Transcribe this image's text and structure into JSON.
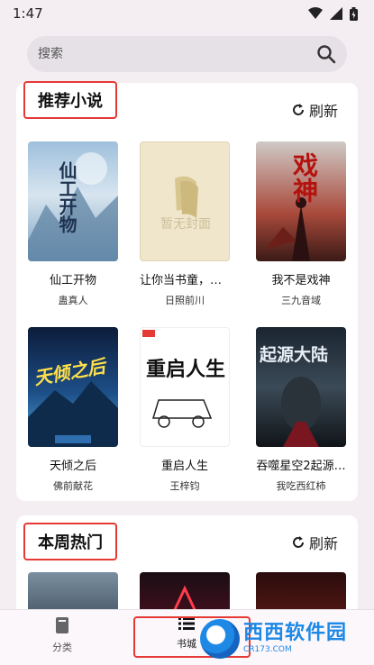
{
  "status": {
    "time": "1:47"
  },
  "search": {
    "placeholder": "搜索"
  },
  "recommend": {
    "title": "推荐小说",
    "refresh_label": "刷新",
    "books": [
      {
        "title": "仙工开物",
        "author": "蛊真人",
        "cover_text": "仙工开物"
      },
      {
        "title": "让你当书童，你…",
        "author": "日照前川",
        "cover_text": "暂无封面"
      },
      {
        "title": "我不是戏神",
        "author": "三九音域",
        "cover_text": "戏神"
      },
      {
        "title": "天倾之后",
        "author": "佛前献花",
        "cover_text": "天倾之后"
      },
      {
        "title": "重启人生",
        "author": "王梓钧",
        "cover_text": "重启人生"
      },
      {
        "title": "吞噬星空2起源…",
        "author": "我吃西红柿",
        "cover_text": "起源大陆"
      }
    ]
  },
  "weekly": {
    "title": "本周热门",
    "refresh_label": "刷新"
  },
  "nav": {
    "items": [
      {
        "label": "分类",
        "icon": "book-icon"
      },
      {
        "label": "书城",
        "icon": "list-icon"
      }
    ]
  },
  "watermark": {
    "main": "西西软件园",
    "sub": "CR173.COM"
  },
  "colors": {
    "highlight": "#e53935",
    "background": "#f4eef3"
  }
}
